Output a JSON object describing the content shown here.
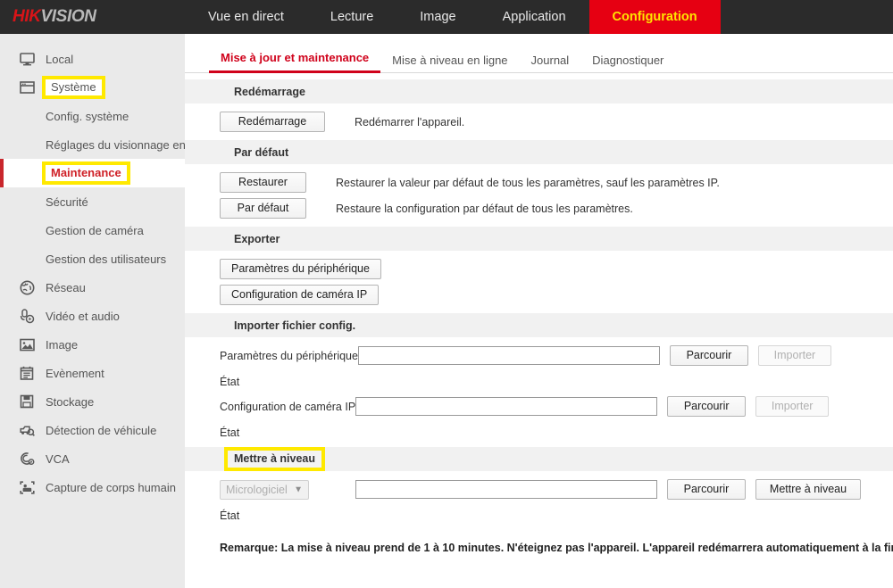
{
  "header": {
    "logo_hik": "HIK",
    "logo_vision": "VISION",
    "nav": [
      {
        "label": "Vue en direct",
        "active": false
      },
      {
        "label": "Lecture",
        "active": false
      },
      {
        "label": "Image",
        "active": false
      },
      {
        "label": "Application",
        "active": false
      },
      {
        "label": "Configuration",
        "active": true
      }
    ],
    "accent_red": "#e60012",
    "accent_yellow": "#ffe400"
  },
  "sidebar": {
    "groups": [
      {
        "icon": "monitor-icon",
        "label": "Local",
        "type": "top",
        "highlight": false
      },
      {
        "icon": "window-icon",
        "label": "Système",
        "type": "top",
        "highlight": true
      },
      {
        "icon": "",
        "label": "Config. système",
        "type": "sub",
        "active": false,
        "highlight": false
      },
      {
        "icon": "",
        "label": "Réglages du visionnage en d",
        "type": "sub",
        "active": false,
        "highlight": false
      },
      {
        "icon": "",
        "label": "Maintenance",
        "type": "sub",
        "active": true,
        "highlight": true
      },
      {
        "icon": "",
        "label": "Sécurité",
        "type": "sub",
        "active": false,
        "highlight": false
      },
      {
        "icon": "",
        "label": "Gestion de caméra",
        "type": "sub",
        "active": false,
        "highlight": false
      },
      {
        "icon": "",
        "label": "Gestion des utilisateurs",
        "type": "sub",
        "active": false,
        "highlight": false
      },
      {
        "icon": "globe-icon",
        "label": "Réseau",
        "type": "top",
        "highlight": false
      },
      {
        "icon": "audio-video-icon",
        "label": "Vidéo et audio",
        "type": "top",
        "highlight": false
      },
      {
        "icon": "picture-icon",
        "label": "Image",
        "type": "top",
        "highlight": false
      },
      {
        "icon": "calendar-icon",
        "label": "Evènement",
        "type": "top",
        "highlight": false
      },
      {
        "icon": "disk-icon",
        "label": "Stockage",
        "type": "top",
        "highlight": false
      },
      {
        "icon": "vehicle-detect-icon",
        "label": "Détection de véhicule",
        "type": "top",
        "highlight": false
      },
      {
        "icon": "vca-icon",
        "label": "VCA",
        "type": "top",
        "highlight": false
      },
      {
        "icon": "human-capture-icon",
        "label": "Capture de corps humain",
        "type": "top",
        "highlight": false
      }
    ]
  },
  "content": {
    "tabs": [
      {
        "label": "Mise à jour et maintenance",
        "active": true
      },
      {
        "label": "Mise à niveau en ligne",
        "active": false
      },
      {
        "label": "Journal",
        "active": false
      },
      {
        "label": "Diagnostiquer",
        "active": false
      }
    ],
    "reboot": {
      "section_title": "Redémarrage",
      "button_label": "Redémarrage",
      "description": "Redémarrer l'appareil."
    },
    "defaults": {
      "section_title": "Par défaut",
      "restore_button": "Restaurer",
      "restore_description": "Restaurer la valeur par défaut de tous les paramètres, sauf les paramètres IP.",
      "default_button": "Par défaut",
      "default_description": "Restaure la configuration par défaut de tous les paramètres."
    },
    "export": {
      "section_title": "Exporter",
      "device_params_button": "Paramètres du périphérique",
      "ip_camera_config_button": "Configuration de caméra IP"
    },
    "import": {
      "section_title": "Importer fichier config.",
      "device_params_label": "Paramètres du périphérique",
      "device_params_value": "",
      "device_params_browse": "Parcourir",
      "device_params_import": "Importer",
      "device_params_status_label": "État",
      "device_params_status_value": "",
      "ip_camera_label": "Configuration de caméra IP",
      "ip_camera_value": "",
      "ip_camera_browse": "Parcourir",
      "ip_camera_import": "Importer",
      "ip_camera_status_label": "État",
      "ip_camera_status_value": ""
    },
    "upgrade": {
      "section_title": "Mettre à niveau",
      "type_selected": "Micrologiciel",
      "type_options": [
        "Micrologiciel"
      ],
      "file_value": "",
      "browse_button": "Parcourir",
      "upgrade_button": "Mettre à niveau",
      "status_label": "État",
      "status_value": "",
      "remark": "Remarque: La mise à niveau prend de 1 à 10 minutes. N'éteignez pas l'appareil. L'appareil redémarrera automatiquement à la fin."
    }
  }
}
